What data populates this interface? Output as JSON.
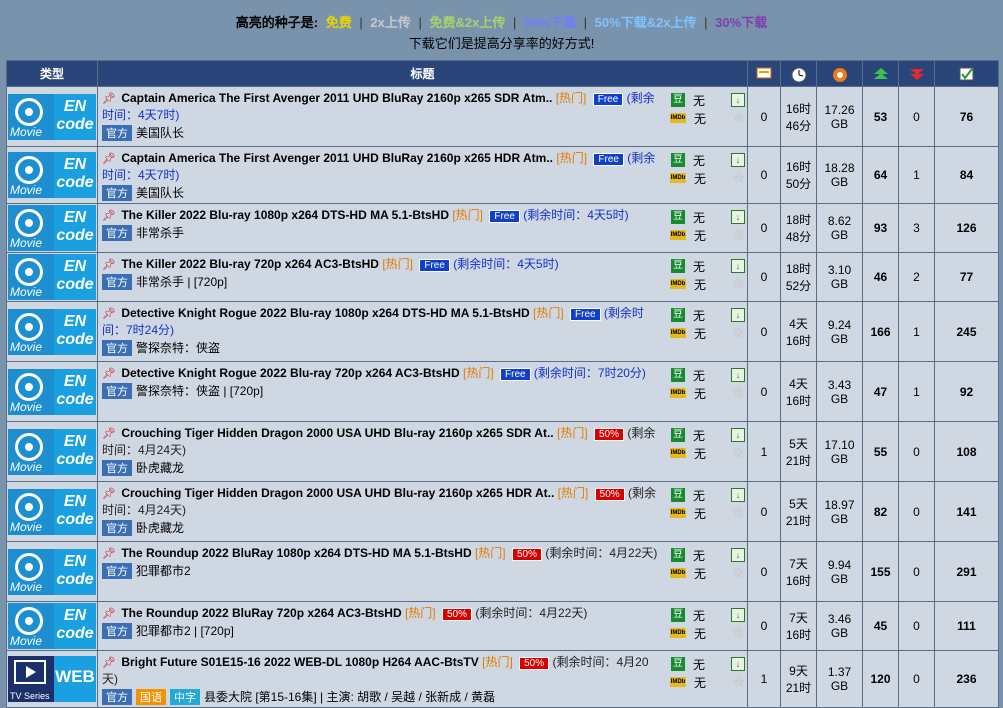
{
  "legend": {
    "label": "高亮的种子是:",
    "free": "免费",
    "twoxup": "2x上传",
    "free_twoxup": "免费&2x上传",
    "half": "50%下载",
    "half_twoxup": "50%下载&2x上传",
    "thirty": "30%下载",
    "line2": "下载它们是提高分享率的好方式!",
    "colors": {
      "free": "#e6d500",
      "twoxup": "#c8c8c8",
      "free_twoxup": "#a6d36a",
      "half": "#6f7cff",
      "half_twoxup": "#7ec3ff",
      "thirty": "#7b3fae"
    }
  },
  "header": {
    "type": "类型",
    "title": "标题",
    "comments_icon": "comments-icon",
    "time_icon": "clock-icon",
    "size_icon": "size-icon",
    "seeders_icon": "seeders-up-icon",
    "leechers_icon": "leechers-down-icon",
    "completed_icon": "completed-check-icon"
  },
  "rows": [
    {
      "cat": "Movie",
      "code": "EN\ncode",
      "name": "Captain America The First Avenger 2011 UHD BluRay 2160p x265 SDR Atm..",
      "hot": "[热门]",
      "promo": "Free",
      "promo_type": "free",
      "remain": "(剩余时间：4天7时)",
      "remain_dark": false,
      "tags": [
        "官方"
      ],
      "subtitle": "美国队长",
      "douban": "无",
      "imdb": "无",
      "comments": "0",
      "time": "16时\n46分",
      "size": "17.26\nGB",
      "seeders": "53",
      "leechers": "0",
      "completed": "76"
    },
    {
      "cat": "Movie",
      "code": "EN\ncode",
      "name": "Captain America The First Avenger 2011 UHD BluRay 2160p x265 HDR Atm..",
      "hot": "[热门]",
      "promo": "Free",
      "promo_type": "free",
      "remain": "(剩余时间：4天7时)",
      "remain_dark": false,
      "tags": [
        "官方"
      ],
      "subtitle": "美国队长",
      "douban": "无",
      "imdb": "无",
      "comments": "0",
      "time": "16时\n50分",
      "size": "18.28\nGB",
      "seeders": "64",
      "leechers": "1",
      "completed": "84"
    },
    {
      "cat": "Movie",
      "code": "EN\ncode",
      "name": "The Killer 2022 Blu-ray 1080p x264 DTS-HD MA 5.1-BtsHD",
      "hot": "[热门]",
      "promo": "Free",
      "promo_type": "free",
      "remain": "(剩余时间：4天5时)",
      "remain_dark": false,
      "tags": [
        "官方"
      ],
      "subtitle": "非常杀手",
      "douban": "无",
      "imdb": "无",
      "comments": "0",
      "time": "18时\n48分",
      "size": "8.62\nGB",
      "seeders": "93",
      "leechers": "3",
      "completed": "126"
    },
    {
      "cat": "Movie",
      "code": "EN\ncode",
      "name": "The Killer 2022 Blu-ray 720p x264 AC3-BtsHD",
      "hot": "[热门]",
      "promo": "Free",
      "promo_type": "free",
      "remain": "(剩余时间：4天5时)",
      "remain_dark": false,
      "tags": [
        "官方"
      ],
      "subtitle": "非常杀手 | [720p]",
      "douban": "无",
      "imdb": "无",
      "comments": "0",
      "time": "18时\n52分",
      "size": "3.10\nGB",
      "seeders": "46",
      "leechers": "2",
      "completed": "77"
    },
    {
      "cat": "Movie",
      "code": "EN\ncode",
      "name": "Detective Knight Rogue 2022 Blu-ray 1080p x264 DTS-HD MA 5.1-BtsHD",
      "hot": "[热门]",
      "promo": "Free",
      "promo_type": "free",
      "remain": "(剩余时间：7时24分)",
      "remain_dark": false,
      "tags": [
        "官方"
      ],
      "subtitle": "警探奈特：侠盗",
      "douban": "无",
      "imdb": "无",
      "comments": "0",
      "time": "4天\n16时",
      "size": "9.24\nGB",
      "seeders": "166",
      "leechers": "1",
      "completed": "245"
    },
    {
      "cat": "Movie",
      "code": "EN\ncode",
      "name": "Detective Knight Rogue 2022 Blu-ray 720p x264 AC3-BtsHD",
      "hot": "[热门]",
      "promo": "Free",
      "promo_type": "free",
      "remain": "(剩余时间：7时20分)",
      "remain_dark": false,
      "tags": [
        "官方"
      ],
      "subtitle": "警探奈特：侠盗 | [720p]",
      "douban": "无",
      "imdb": "无",
      "comments": "0",
      "time": "4天\n16时",
      "size": "3.43\nGB",
      "seeders": "47",
      "leechers": "1",
      "completed": "92"
    },
    {
      "cat": "Movie",
      "code": "EN\ncode",
      "name": "Crouching Tiger Hidden Dragon 2000 USA UHD Blu-ray 2160p x265 SDR At..",
      "hot": "[热门]",
      "promo": "50%",
      "promo_type": "half",
      "remain": "(剩余时间：4月24天)",
      "remain_dark": true,
      "tags": [
        "官方"
      ],
      "subtitle": "卧虎藏龙",
      "douban": "无",
      "imdb": "无",
      "comments": "1",
      "time": "5天\n21时",
      "size": "17.10\nGB",
      "seeders": "55",
      "leechers": "0",
      "completed": "108"
    },
    {
      "cat": "Movie",
      "code": "EN\ncode",
      "name": "Crouching Tiger Hidden Dragon 2000 USA UHD Blu-ray 2160p x265 HDR At..",
      "hot": "[热门]",
      "promo": "50%",
      "promo_type": "half",
      "remain": "(剩余时间：4月24天)",
      "remain_dark": true,
      "tags": [
        "官方"
      ],
      "subtitle": "卧虎藏龙",
      "douban": "无",
      "imdb": "无",
      "comments": "0",
      "time": "5天\n21时",
      "size": "18.97\nGB",
      "seeders": "82",
      "leechers": "0",
      "completed": "141"
    },
    {
      "cat": "Movie",
      "code": "EN\ncode",
      "name": "The Roundup 2022 BluRay 1080p x264 DTS-HD MA 5.1-BtsHD",
      "hot": "[热门]",
      "promo": "50%",
      "promo_type": "half",
      "remain": "(剩余时间：4月22天)",
      "remain_dark": true,
      "tags": [
        "官方"
      ],
      "subtitle": "犯罪都市2",
      "douban": "无",
      "imdb": "无",
      "comments": "0",
      "time": "7天\n16时",
      "size": "9.94\nGB",
      "seeders": "155",
      "leechers": "0",
      "completed": "291"
    },
    {
      "cat": "Movie",
      "code": "EN\ncode",
      "name": "The Roundup 2022 BluRay 720p x264 AC3-BtsHD",
      "hot": "[热门]",
      "promo": "50%",
      "promo_type": "half",
      "remain": "(剩余时间：4月22天)",
      "remain_dark": true,
      "tags": [
        "官方"
      ],
      "subtitle": "犯罪都市2 | [720p]",
      "douban": "无",
      "imdb": "无",
      "comments": "0",
      "time": "7天\n16时",
      "size": "3.46\nGB",
      "seeders": "45",
      "leechers": "0",
      "completed": "111"
    },
    {
      "cat": "TV Series",
      "code": "WEB",
      "name": "Bright Future S01E15-16 2022 WEB-DL 1080p H264 AAC-BtsTV",
      "hot": "[热门]",
      "promo": "50%",
      "promo_type": "half",
      "remain": "(剩余时间：4月20天)",
      "remain_dark": true,
      "tags": [
        "官方",
        "国语",
        "中字"
      ],
      "subtitle": "县委大院 [第15-16集] | 主演: 胡歌 / 吴越 / 张新成 / 黄磊",
      "douban": "无",
      "imdb": "无",
      "comments": "1",
      "time": "9天\n21时",
      "size": "1.37\nGB",
      "seeders": "120",
      "leechers": "0",
      "completed": "236"
    }
  ]
}
